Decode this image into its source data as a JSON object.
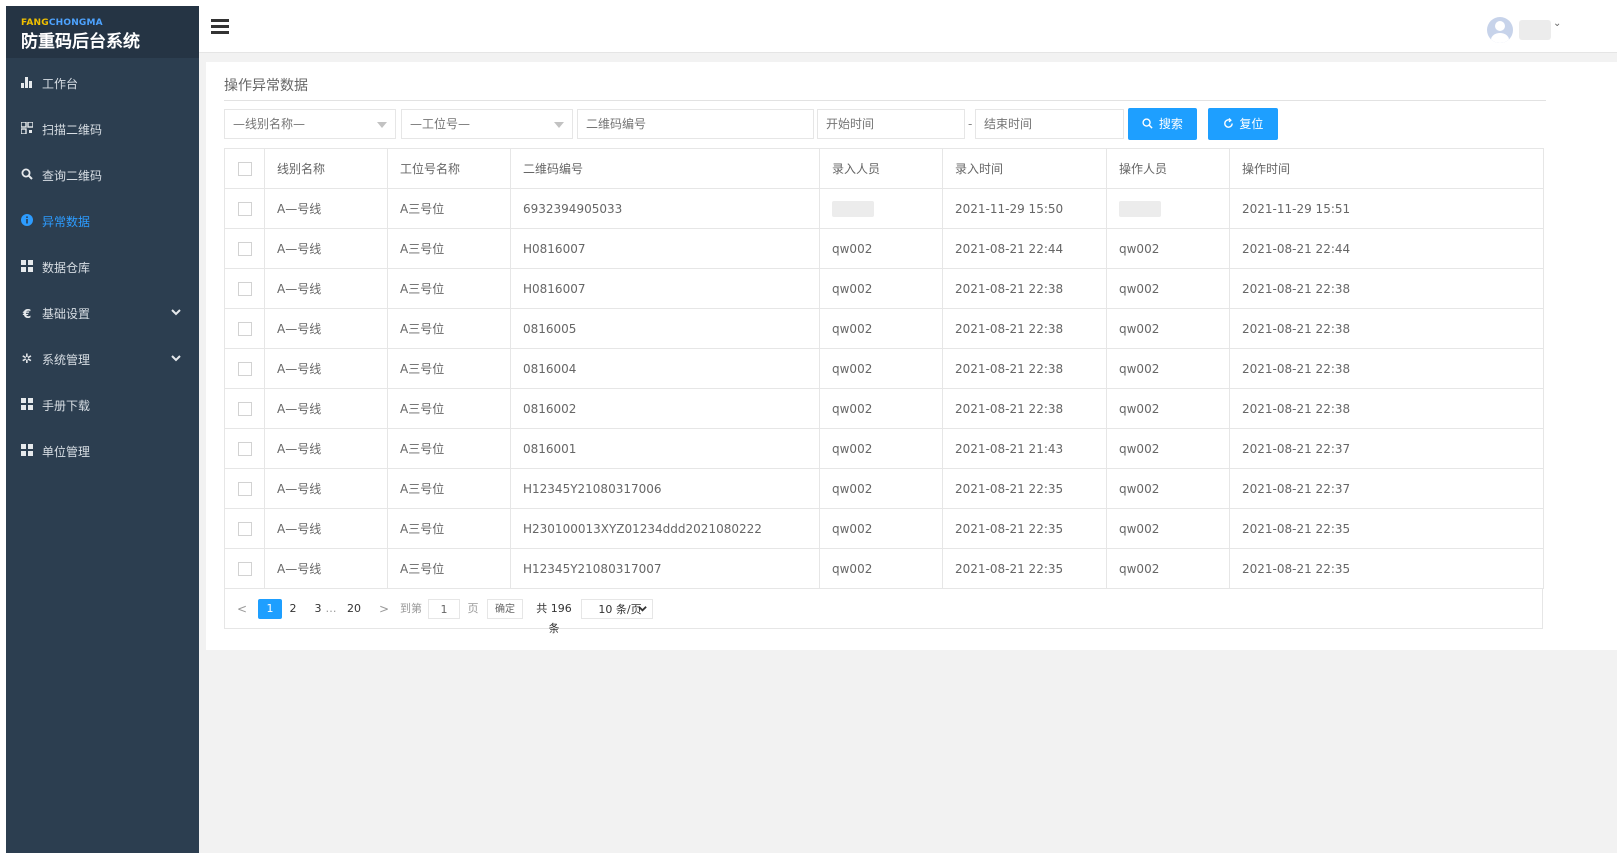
{
  "sidebar": {
    "brand_part1": "FANG",
    "brand_part2": "CHONGMA",
    "title": "防重码后台系统",
    "items": [
      {
        "label": "工作台",
        "icon": "bar-chart-icon"
      },
      {
        "label": "扫描二维码",
        "icon": "qrcode-icon"
      },
      {
        "label": "查询二维码",
        "icon": "search-icon"
      },
      {
        "label": "异常数据",
        "icon": "info-circle-icon",
        "active": true
      },
      {
        "label": "数据仓库",
        "icon": "grid-icon"
      },
      {
        "label": "基础设置",
        "icon": "euro-icon",
        "expandable": true
      },
      {
        "label": "系统管理",
        "icon": "gear-icon",
        "expandable": true
      },
      {
        "label": "手册下载",
        "icon": "grid-icon"
      },
      {
        "label": "单位管理",
        "icon": "grid-icon"
      }
    ]
  },
  "panel": {
    "title": "操作异常数据"
  },
  "filters": {
    "line_select": "—线别名称—",
    "station_select": "—工位号—",
    "qr_placeholder": "二维码编号",
    "start_placeholder": "开始时间",
    "date_separator": "-",
    "end_placeholder": "结束时间",
    "search_label": "搜索",
    "reset_label": "复位"
  },
  "table": {
    "headers": [
      "线别名称",
      "工位号名称",
      "二维码编号",
      "录入人员",
      "录入时间",
      "操作人员",
      "操作时间"
    ],
    "rows": [
      [
        "A—号线",
        "A三号位",
        "6932394905033",
        "",
        "2021-11-29 15:50",
        "",
        "2021-11-29 15:51"
      ],
      [
        "A—号线",
        "A三号位",
        "H0816007",
        "qw002",
        "2021-08-21 22:44",
        "qw002",
        "2021-08-21 22:44"
      ],
      [
        "A—号线",
        "A三号位",
        "H0816007",
        "qw002",
        "2021-08-21 22:38",
        "qw002",
        "2021-08-21 22:38"
      ],
      [
        "A—号线",
        "A三号位",
        "0816005",
        "qw002",
        "2021-08-21 22:38",
        "qw002",
        "2021-08-21 22:38"
      ],
      [
        "A—号线",
        "A三号位",
        "0816004",
        "qw002",
        "2021-08-21 22:38",
        "qw002",
        "2021-08-21 22:38"
      ],
      [
        "A—号线",
        "A三号位",
        "0816002",
        "qw002",
        "2021-08-21 22:38",
        "qw002",
        "2021-08-21 22:38"
      ],
      [
        "A—号线",
        "A三号位",
        "0816001",
        "qw002",
        "2021-08-21 21:43",
        "qw002",
        "2021-08-21 22:37"
      ],
      [
        "A—号线",
        "A三号位",
        "H12345Y21080317006",
        "qw002",
        "2021-08-21 22:35",
        "qw002",
        "2021-08-21 22:37"
      ],
      [
        "A—号线",
        "A三号位",
        "H230100013XYZ01234ddd2021080222",
        "qw002",
        "2021-08-21 22:35",
        "qw002",
        "2021-08-21 22:35"
      ],
      [
        "A—号线",
        "A三号位",
        "H12345Y21080317007",
        "qw002",
        "2021-08-21 22:35",
        "qw002",
        "2021-08-21 22:35"
      ]
    ]
  },
  "pager": {
    "prev": "<",
    "pages": [
      "1",
      "2",
      "3"
    ],
    "ellipsis": "…",
    "last_page": "20",
    "next": ">",
    "goto_label": "到第",
    "goto_value": "1",
    "page_unit": "页",
    "confirm_label": "确定",
    "total_text": "共 196 条",
    "page_size": "10 条/页"
  }
}
